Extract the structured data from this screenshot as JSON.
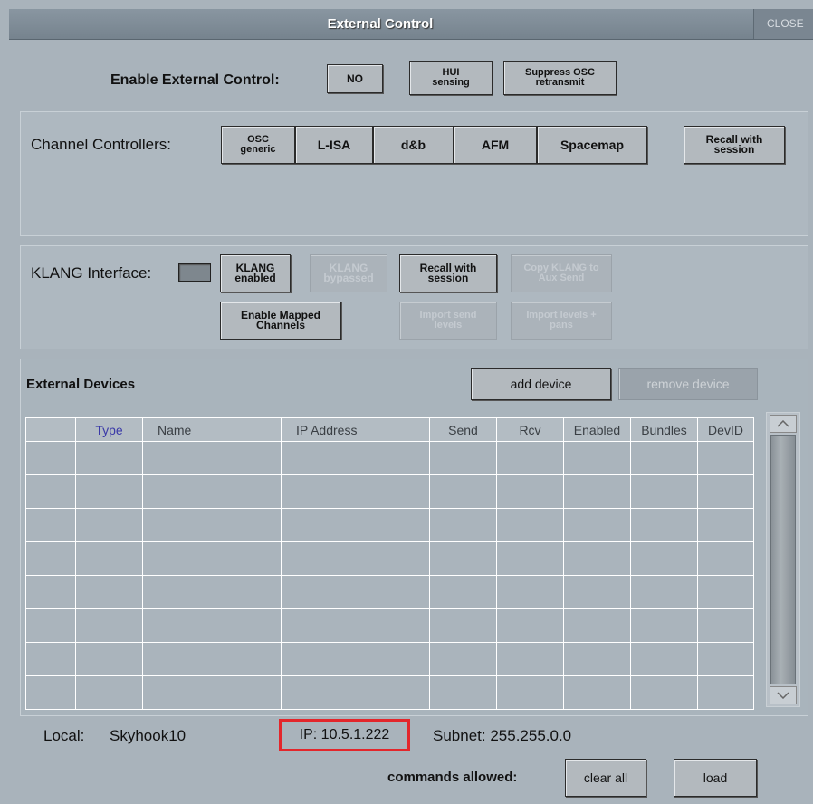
{
  "window": {
    "title": "External Control",
    "close_label": "CLOSE"
  },
  "enable_row": {
    "label": "Enable External Control:",
    "no_label": "NO",
    "hui_label": "HUI sensing",
    "suppress_label": "Suppress OSC retransmit"
  },
  "channel_controllers": {
    "label": "Channel Controllers:",
    "buttons": [
      "OSC generic",
      "L-ISA",
      "d&b",
      "AFM",
      "Spacemap"
    ],
    "recall_label": "Recall with session"
  },
  "klang": {
    "label": "KLANG Interface:",
    "enabled_label": "KLANG enabled",
    "bypassed_label": "KLANG bypassed",
    "recall_label": "Recall with session",
    "copy_label": "Copy KLANG to Aux Send",
    "enable_mapped_label": "Enable Mapped Channels",
    "import_send_label": "Import send levels",
    "import_levels_label": "Import levels + pans"
  },
  "devices": {
    "title": "External Devices",
    "add_label": "add device",
    "remove_label": "remove device",
    "columns": [
      "",
      "Type",
      "Name",
      "IP Address",
      "Send",
      "Rcv",
      "Enabled",
      "Bundles",
      "DevID"
    ],
    "row_count": 8
  },
  "footer": {
    "local_label": "Local:",
    "local_name": "Skyhook10",
    "ip": "IP: 10.5.1.222",
    "subnet": "Subnet: 255.255.0.0",
    "commands_label": "commands allowed:",
    "clear_all_label": "clear all",
    "load_label": "load"
  },
  "colors": {
    "highlight_border": "#e3262b",
    "type_header": "#3a39a8"
  }
}
